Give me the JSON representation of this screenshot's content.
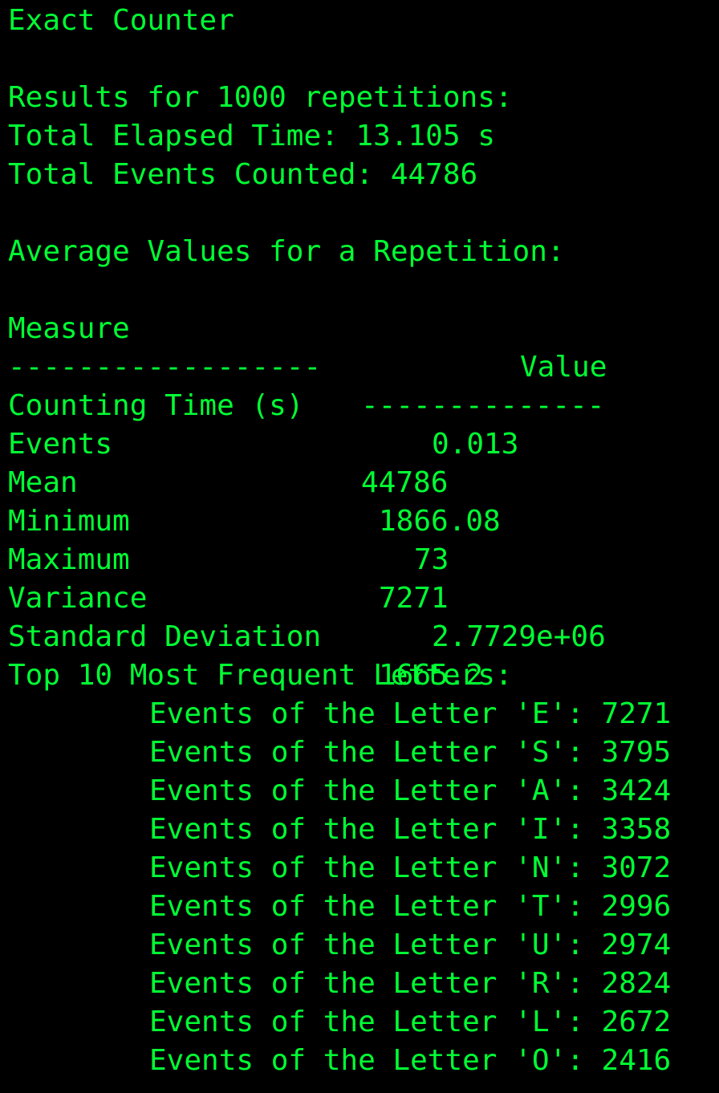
{
  "title": "Exact Counter",
  "summary": {
    "results_line": "Results for 1000 repetitions:",
    "elapsed_line": "Total Elapsed Time: 13.105 s",
    "events_line": "Total Events Counted: 44786"
  },
  "averages": {
    "heading": "Average Values for a Repetition:",
    "header_measure": "Measure",
    "header_value": "Value",
    "separator_measure": "------------------",
    "separator_value": "--------------",
    "rows": [
      {
        "measure": "Counting Time (s)",
        "value": "0.013"
      },
      {
        "measure": "Events",
        "value": "44786"
      },
      {
        "measure": "Mean",
        "value": "1866.08"
      },
      {
        "measure": "Minimum",
        "value": "73"
      },
      {
        "measure": "Maximum",
        "value": "7271"
      },
      {
        "measure": "Variance",
        "value": "2.7729e+06"
      },
      {
        "measure": "Standard Deviation",
        "value": "1665.2"
      }
    ]
  },
  "top_letters": {
    "heading": "Top 10 Most Frequent Letters:",
    "items": [
      "Events of the Letter 'E': 7271",
      "Events of the Letter 'S': 3795",
      "Events of the Letter 'A': 3424",
      "Events of the Letter 'I': 3358",
      "Events of the Letter 'N': 3072",
      "Events of the Letter 'T': 2996",
      "Events of the Letter 'U': 2974",
      "Events of the Letter 'R': 2824",
      "Events of the Letter 'L': 2672",
      "Events of the Letter 'O': 2416"
    ]
  },
  "colors": {
    "background": "#000000",
    "text": "#00ff33"
  }
}
